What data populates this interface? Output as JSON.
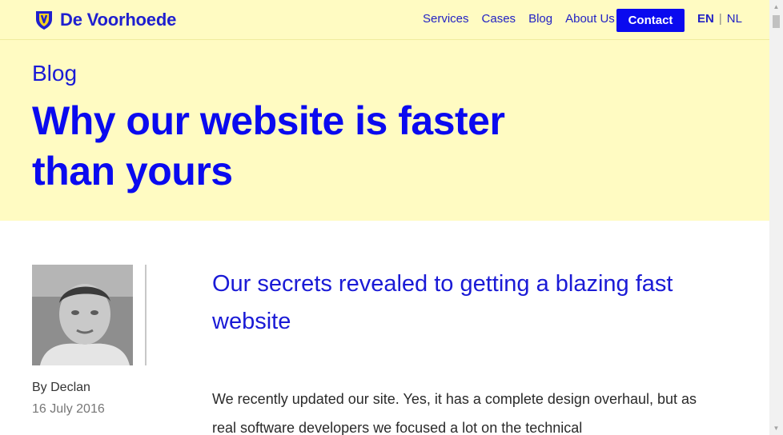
{
  "header": {
    "brand": "De Voorhoede",
    "nav": [
      "Services",
      "Cases",
      "Blog",
      "About Us"
    ],
    "contact_label": "Contact",
    "lang_active": "EN",
    "lang_separator": "|",
    "lang_other": "NL"
  },
  "hero": {
    "kicker": "Blog",
    "title": "Why our website is faster than yours"
  },
  "author": {
    "byline": "By Declan",
    "date": "16 July 2016"
  },
  "article": {
    "subhead": "Our secrets revealed to getting a blazing fast website",
    "intro": "We recently updated our site. Yes, it has a complete design overhaul, but as real software developers we focused a lot on the technical"
  },
  "colors": {
    "brand_blue": "#0a0aef",
    "hero_bg": "#fffbc2",
    "logo_yellow": "#f4d21f"
  },
  "icons": [
    "logo-shield-icon",
    "scroll-up-arrow-icon",
    "scroll-down-arrow-icon"
  ]
}
